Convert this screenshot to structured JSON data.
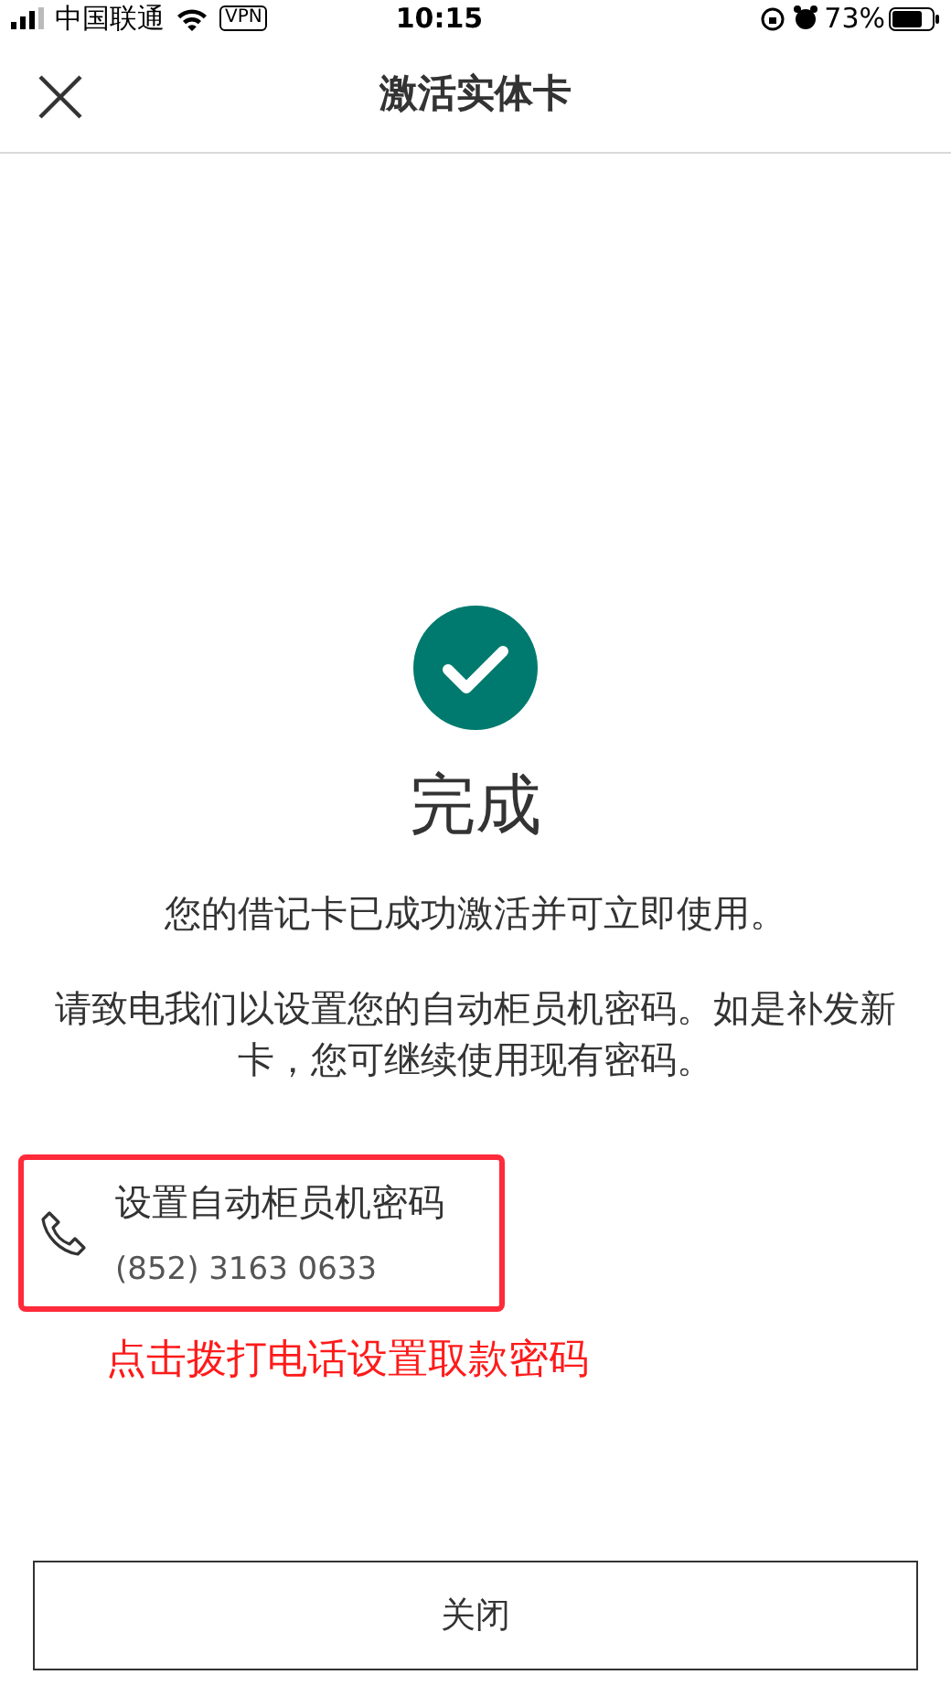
{
  "status_bar": {
    "carrier": "中国联通",
    "vpn": "VPN",
    "time": "10:15",
    "battery": "73%"
  },
  "header": {
    "title": "激活实体卡"
  },
  "result": {
    "title": "完成",
    "message": "您的借记卡已成功激活并可立即使用。",
    "note": "请致电我们以设置您的自动柜员机密码。如是补发新卡，您可继续使用现有密码。"
  },
  "contact": {
    "label": "设置自动柜员机密码",
    "phone": "(852) 3163 0633",
    "highlighted": true
  },
  "annotation": "点击拨打电话设置取款密码",
  "close_button": "关闭"
}
